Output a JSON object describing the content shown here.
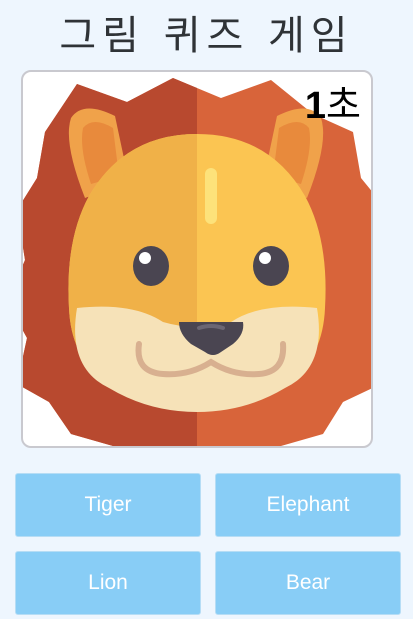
{
  "title": "그림 퀴즈 게임",
  "quiz_image": {
    "subject_icon": "lion-icon"
  },
  "timer": {
    "value": "1",
    "unit": "초"
  },
  "answers": [
    {
      "label": "Tiger"
    },
    {
      "label": "Elephant"
    },
    {
      "label": "Lion"
    },
    {
      "label": "Bear"
    }
  ],
  "colors": {
    "background": "#eef6fe",
    "button": "#88cdf6",
    "button_text": "#ffffff",
    "mane_dark": "#b8492f",
    "mane_light": "#d8643a",
    "face": "#fbc552",
    "muzzle": "#f6e2b8"
  }
}
